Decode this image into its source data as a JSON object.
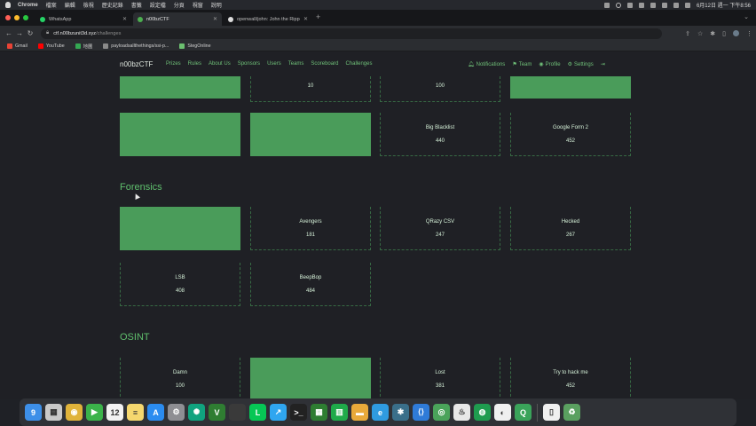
{
  "menubar": {
    "items": [
      "Chrome",
      "檔案",
      "編輯",
      "檢視",
      "歷史記錄",
      "書籤",
      "設定檔",
      "分頁",
      "視窗",
      "說明"
    ],
    "time": "6月12日 週一 下午8:56"
  },
  "tabs": [
    {
      "title": "WhatsApp",
      "color": "#25d366"
    },
    {
      "title": "n00bzCTF",
      "color": "#4caf50"
    },
    {
      "title": "openwall/john: John the Rippe",
      "color": "#dddddd"
    }
  ],
  "address": {
    "host": "ctf.n00bzunit3d.xyz",
    "path": "/challenges"
  },
  "bookmarks": [
    {
      "label": "Gmail",
      "color": "#ea4335"
    },
    {
      "label": "YouTube",
      "color": "#ff0000"
    },
    {
      "label": "地圖",
      "color": "#34a853"
    },
    {
      "label": "payloadsallthethings/ssi-p...",
      "color": "#8a8a8a"
    },
    {
      "label": "StegOnline",
      "color": "#6cc070"
    }
  ],
  "nav": {
    "brand": "n00bzCTF",
    "links": [
      "Prizes",
      "Rules",
      "About Us",
      "Sponsors",
      "Users",
      "Teams",
      "Scoreboard",
      "Challenges"
    ],
    "right": [
      "Notifications",
      "Team",
      "Profile",
      "Settings"
    ]
  },
  "sections": {
    "row_top": [
      {
        "name": "",
        "points": "",
        "solved": true
      },
      {
        "name": "",
        "points": "10",
        "solved": false
      },
      {
        "name": "",
        "points": "100",
        "solved": false
      },
      {
        "name": "",
        "points": "",
        "solved": true
      }
    ],
    "row_second": [
      {
        "name": "",
        "points": "",
        "solved": true
      },
      {
        "name": "",
        "points": "",
        "solved": true
      },
      {
        "name": "Big Blacklist",
        "points": "440",
        "solved": false
      },
      {
        "name": "Google Form 2",
        "points": "452",
        "solved": false
      }
    ],
    "forensics_title": "Forensics",
    "forensics": [
      {
        "name": "",
        "points": "",
        "solved": true
      },
      {
        "name": "Avengers",
        "points": "181",
        "solved": false
      },
      {
        "name": "QRazy CSV",
        "points": "247",
        "solved": false
      },
      {
        "name": "Hecked",
        "points": "267",
        "solved": false
      },
      {
        "name": "LSB",
        "points": "408",
        "solved": false
      },
      {
        "name": "BeepBop",
        "points": "484",
        "solved": false
      }
    ],
    "osint_title": "OSINT",
    "osint": [
      {
        "name": "Damn",
        "points": "100",
        "solved": false
      },
      {
        "name": "",
        "points": "",
        "solved": true
      },
      {
        "name": "Lost",
        "points": "381",
        "solved": false
      },
      {
        "name": "Try to hack me",
        "points": "452",
        "solved": false
      }
    ]
  },
  "dock": [
    {
      "name": "finder-icon",
      "color": "#3d8fe8",
      "glyph": "9"
    },
    {
      "name": "launchpad-icon",
      "color": "#c9c9c9",
      "glyph": "▦"
    },
    {
      "name": "chrome-icon",
      "color": "#e0b33a",
      "glyph": "◉"
    },
    {
      "name": "facetime-icon",
      "color": "#3bb34a",
      "glyph": "▶"
    },
    {
      "name": "calendar-icon",
      "color": "#f2f2f2",
      "glyph": "12"
    },
    {
      "name": "notes-icon",
      "color": "#f5d76e",
      "glyph": "≡"
    },
    {
      "name": "appstore-icon",
      "color": "#2b8cf0",
      "glyph": "A"
    },
    {
      "name": "settings-icon",
      "color": "#8e8e93",
      "glyph": "⚙"
    },
    {
      "name": "chatgpt-icon",
      "color": "#10a37f",
      "glyph": "✺"
    },
    {
      "name": "vim-icon",
      "color": "#2f7d32",
      "glyph": "V"
    },
    {
      "name": "blank-icon",
      "color": "#3a3a3a",
      "glyph": ""
    },
    {
      "name": "line-icon",
      "color": "#06c755",
      "glyph": "L"
    },
    {
      "name": "stocks-icon",
      "color": "#2fa6f0",
      "glyph": "↗"
    },
    {
      "name": "terminal-icon",
      "color": "#222",
      "glyph": ">_"
    },
    {
      "name": "grid-icon",
      "color": "#2e7d32",
      "glyph": "▦"
    },
    {
      "name": "numbers-icon",
      "color": "#1faa4a",
      "glyph": "▥"
    },
    {
      "name": "folder-icon",
      "color": "#e8a93a",
      "glyph": "▬"
    },
    {
      "name": "edge-icon",
      "color": "#2f9be0",
      "glyph": "e"
    },
    {
      "name": "network-icon",
      "color": "#3a6f8a",
      "glyph": "✱"
    },
    {
      "name": "vscode-icon",
      "color": "#2f7bd8",
      "glyph": "⟨⟩"
    },
    {
      "name": "browser-icon",
      "color": "#4aa35a",
      "glyph": "◎"
    },
    {
      "name": "java-icon",
      "color": "#e8e8e8",
      "glyph": "♨"
    },
    {
      "name": "edge-green-icon",
      "color": "#1f9c4f",
      "glyph": "◍"
    },
    {
      "name": "vpn-icon",
      "color": "#f0f0f0",
      "glyph": "◐"
    },
    {
      "name": "copilot-icon",
      "color": "#3aa35a",
      "glyph": "Q"
    },
    {
      "name": "document-icon",
      "color": "#f0f0f0",
      "glyph": "▯"
    },
    {
      "name": "trash-icon",
      "color": "#5aa060",
      "glyph": "♻"
    }
  ]
}
